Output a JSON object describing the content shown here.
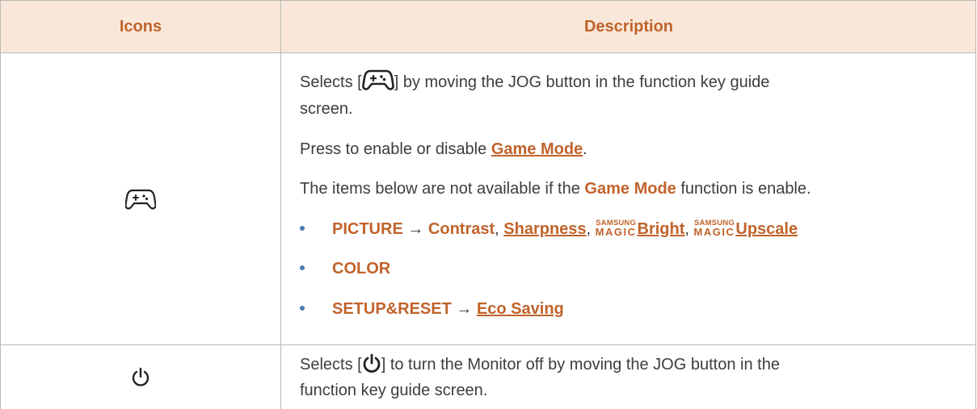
{
  "table": {
    "header": {
      "col_icons": "Icons",
      "col_description": "Description"
    },
    "row1": {
      "icon": "gamepad-icon",
      "line1_a": "Selects [",
      "line1_b": "] by moving the JOG button in the function key guide",
      "line2": "screen.",
      "line3_a": "Press to enable or disable ",
      "line3_link": "Game Mode",
      "line3_b": ".",
      "line4_a": "The items below are not available if the ",
      "line4_b": "Game Mode",
      "line4_c": " function is enable.",
      "bullets": [
        {
          "menu": "PICTURE",
          "arrow": "→",
          "item1": "Contrast",
          "sep1": ", ",
          "item2": "Sharpness",
          "sep2": ", ",
          "brand_top": "SAMSUNG",
          "brand_bottom": "MAGIC",
          "item3": "Bright",
          "sep3": ", ",
          "item4": "Upscale"
        },
        {
          "menu": "COLOR"
        },
        {
          "menu": "SETUP&RESET",
          "arrow": "→",
          "item1": "Eco Saving"
        }
      ]
    },
    "row2": {
      "icon": "power-icon",
      "line1_a": "Selects [",
      "line1_b": "] to turn the Monitor off by moving the JOG button in the",
      "line2": "function key guide screen."
    }
  },
  "colors": {
    "accent": "#c0632b",
    "header_bg": "#f9e8d9",
    "bullet": "#4a7bb5",
    "border": "#b8b8b8"
  }
}
